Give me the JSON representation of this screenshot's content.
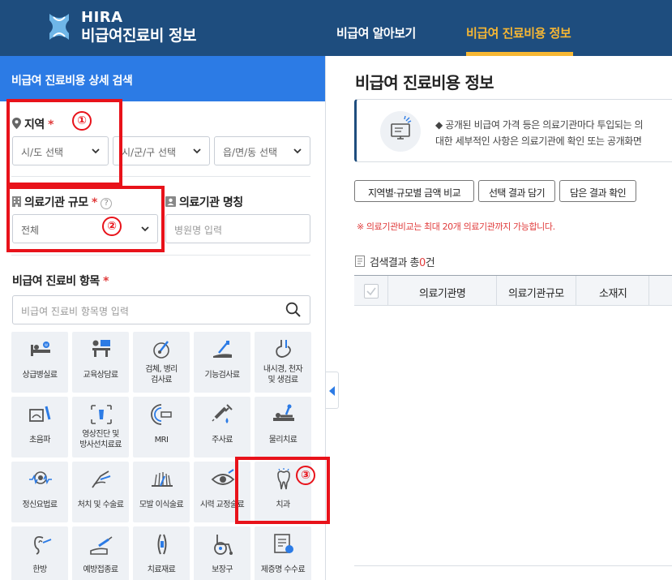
{
  "header": {
    "logo_top": "HIRA",
    "logo_sub": "비급여진료비 정보",
    "nav": [
      "비급여 알아보기",
      "비급여 진료비용 정보"
    ]
  },
  "left": {
    "title": "비급여 진료비용 상세 검색",
    "region": {
      "label": "지역",
      "req": "*",
      "selects": [
        "시/도 선택",
        "시/군/구 선택",
        "읍/면/동 선택"
      ]
    },
    "size": {
      "label": "의료기관 규모",
      "req": "*",
      "help": "?",
      "value": "전체"
    },
    "name": {
      "label": "의료기관 명칭",
      "placeholder": "병원명 입력"
    },
    "items": {
      "label": "비급여 진료비 항목",
      "req": "*",
      "placeholder": "비급여 진료비 항목명 입력"
    },
    "tiles": [
      [
        "상급병실료"
      ],
      [
        "교육상담료"
      ],
      [
        "검체, 병리",
        "검사료"
      ],
      [
        "기능검사료"
      ],
      [
        "내시경, 천자",
        "및 생검료"
      ],
      [
        "초음파"
      ],
      [
        "영상진단 및",
        "방사선치료료"
      ],
      [
        "MRI"
      ],
      [
        "주사료"
      ],
      [
        "물리치료"
      ],
      [
        "정신요법료"
      ],
      [
        "처치 및 수술료"
      ],
      [
        "모발 이식술료"
      ],
      [
        "시력 교정술료"
      ],
      [
        "치과"
      ],
      [
        "한방"
      ],
      [
        "예방접종료"
      ],
      [
        "치료재료"
      ],
      [
        "보장구"
      ],
      [
        "제증명 수수료"
      ]
    ]
  },
  "right": {
    "title": "비급여 진료비용 정보",
    "notice_line1": "◆ 공개된 비급여 가격 등은 의료기관마다 투입되는 의",
    "notice_line2": "대한 세부적인 사항은 의료기관에 확인 또는 공개화면",
    "buttons": [
      "지역별·규모별 금액 비교",
      "선택 결과 담기",
      "담은 결과 확인"
    ],
    "warning": "※ 의료기관비교는 최대 20개 의료기관까지 가능합니다.",
    "result_prefix": "검색결과 총",
    "result_count": "0",
    "result_suffix": "건",
    "columns": [
      "의료기관명",
      "의료기관규모",
      "소재지"
    ]
  },
  "annotations": [
    "①",
    "②",
    "③"
  ],
  "colors": {
    "header": "#1e4d7e",
    "accent_blue": "#2c7be5",
    "nav_active": "#f7b733",
    "required": "#e03b3b",
    "annotation_red": "#e8121a",
    "tile_bg": "#eef1f5"
  }
}
